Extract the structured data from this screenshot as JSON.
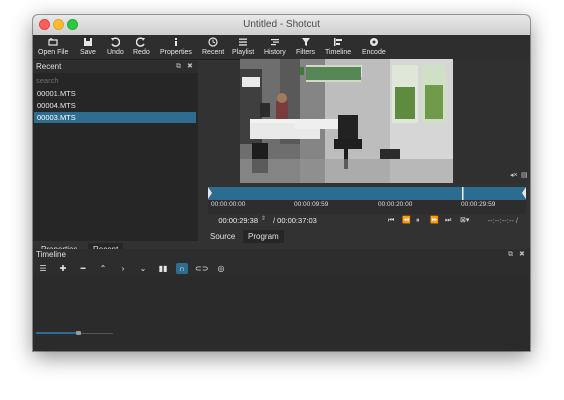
{
  "window": {
    "title": "Untitled - Shotcut"
  },
  "toolbar": {
    "items": [
      {
        "label": "Open File",
        "icon": "open-file-icon"
      },
      {
        "label": "Save",
        "icon": "save-icon"
      },
      {
        "label": "Undo",
        "icon": "undo-icon"
      },
      {
        "label": "Redo",
        "icon": "redo-icon"
      },
      {
        "label": "Properties",
        "icon": "info-icon"
      },
      {
        "label": "Recent",
        "icon": "recent-icon"
      },
      {
        "label": "Playlist",
        "icon": "playlist-icon"
      },
      {
        "label": "History",
        "icon": "history-icon"
      },
      {
        "label": "Filters",
        "icon": "filter-icon"
      },
      {
        "label": "Timeline",
        "icon": "timeline-icon"
      },
      {
        "label": "Encode",
        "icon": "encode-icon"
      }
    ]
  },
  "recent": {
    "title": "Recent",
    "search_placeholder": "search",
    "files": [
      "00001.MTS",
      "00004.MTS",
      "00003.MTS"
    ],
    "selected_index": 2
  },
  "bottom_tabs": {
    "properties": "Properties",
    "recent": "Recent"
  },
  "player": {
    "ruler_labels": [
      "00:00:00:00",
      "00:00:09:59",
      "00:00:20:00",
      "00:00:29:59"
    ],
    "current_timecode": "00:00:29:38",
    "total_duration": "/ 00:00:37:03",
    "in_out_readout": "--:--:--:-- /",
    "playhead_fraction": 0.8,
    "tabs": {
      "source": "Source",
      "program": "Program"
    }
  },
  "timeline": {
    "title": "Timeline",
    "zoom_fraction": 0.53
  },
  "colors": {
    "accent": "#2f6d8f",
    "window_bg": "#323232",
    "panel_bg": "#262626"
  }
}
